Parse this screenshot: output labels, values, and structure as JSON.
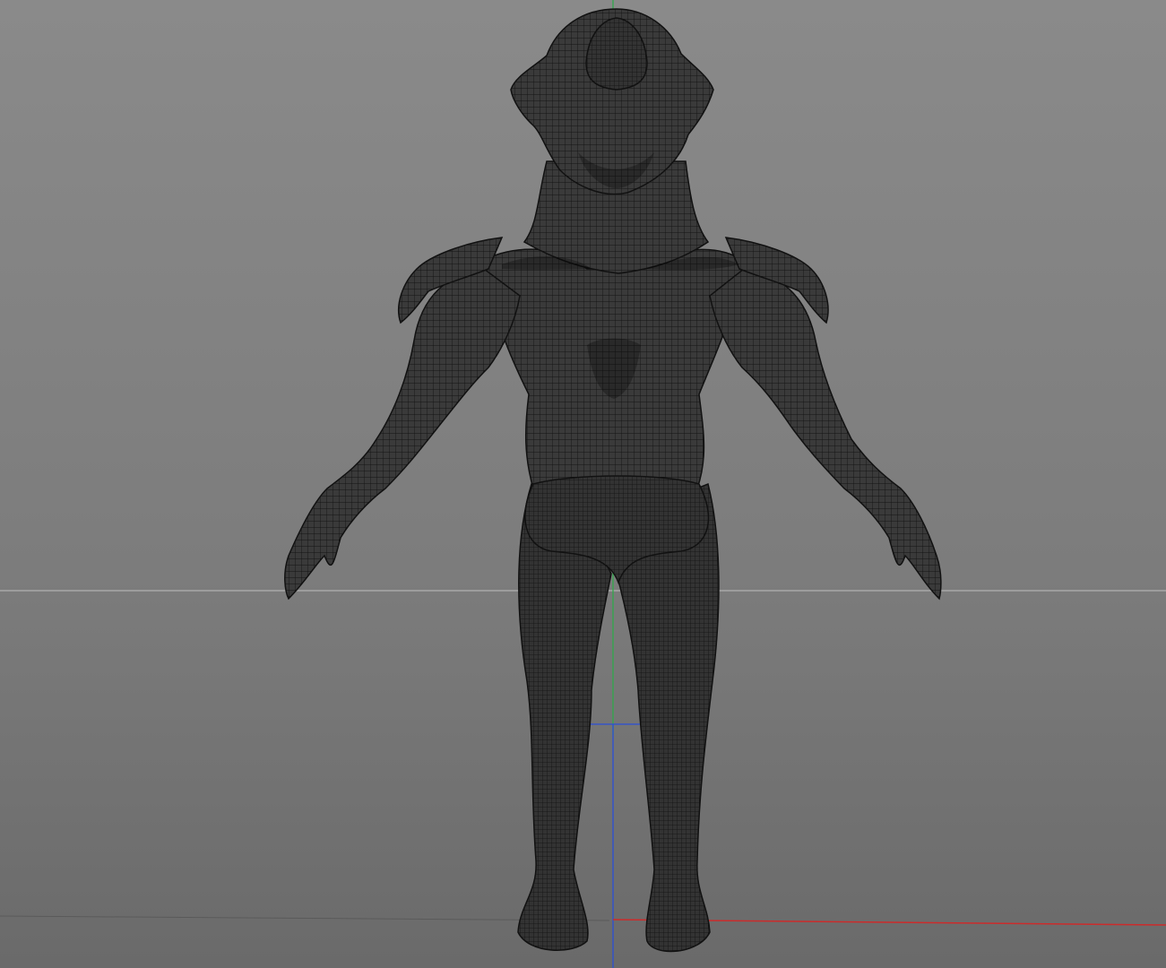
{
  "viewport": {
    "view": "front",
    "display_mode": "wireframe",
    "colors": {
      "background_top": "#8a8a8a",
      "background_bottom": "#6a6a6a",
      "mesh_fill": "#3a3a3a",
      "wire": "#161616",
      "horizon_line": "#a8a8a8",
      "axis_x": "#cc2b2b",
      "axis_y": "#2fa84a",
      "axis_z": "#2b4fd6"
    },
    "model": {
      "name_icon": "creature-mesh",
      "pose": "a-pose"
    },
    "gizmo_icon": "world-axis-gizmo"
  }
}
